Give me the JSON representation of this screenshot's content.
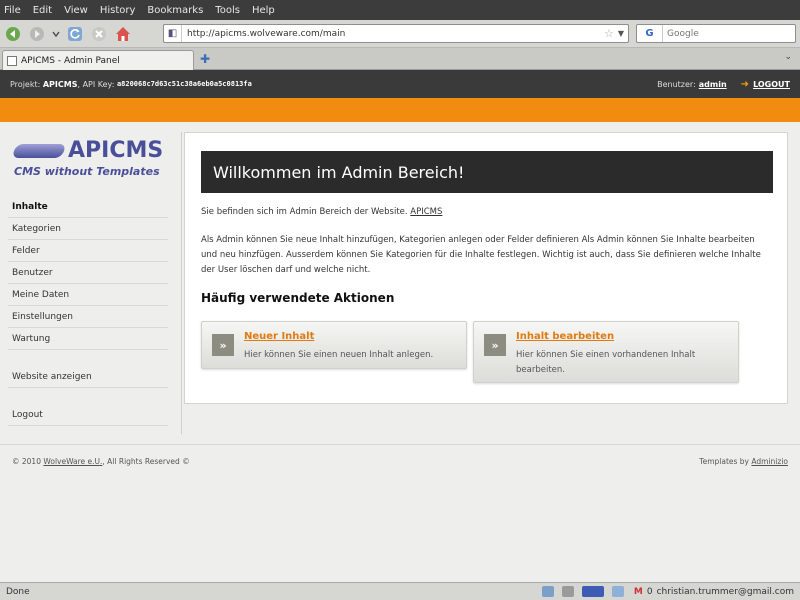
{
  "browser": {
    "menu": [
      "File",
      "Edit",
      "View",
      "History",
      "Bookmarks",
      "Tools",
      "Help"
    ],
    "url": "http://apicms.wolveware.com/main",
    "search_placeholder": "Google",
    "search_engine": "G",
    "tab_title": "APICMS - Admin Panel",
    "new_tab": "✚",
    "tab_list": "⌄",
    "status": "Done",
    "status_mail": "0",
    "status_email": "christian.trummer@gmail.com"
  },
  "adminbar": {
    "project_label": "Projekt:",
    "project_name": "APICMS",
    "api_label": "API Key:",
    "api_key": "a820068c7d63c51c38a6eb0a5c0813fa",
    "user_label": "Benutzer:",
    "user_name": "admin",
    "logout": "LOGOUT"
  },
  "logo": {
    "name": "APICMS",
    "tagline": "CMS without Templates"
  },
  "sidebar": {
    "items": [
      {
        "label": "Inhalte"
      },
      {
        "label": "Kategorien"
      },
      {
        "label": "Felder"
      },
      {
        "label": "Benutzer"
      },
      {
        "label": "Meine Daten"
      },
      {
        "label": "Einstellungen"
      },
      {
        "label": "Wartung"
      }
    ],
    "view_website": "Website anzeigen",
    "logout": "Logout"
  },
  "main": {
    "heading": "Willkommen im Admin Bereich!",
    "intro_prefix": "Sie befinden sich im Admin Bereich der Website.",
    "intro_link": "APICMS",
    "body": "Als Admin können Sie neue Inhalt hinzufügen, Kategorien anlegen oder Felder definieren Als Admin können Sie Inhalte bearbeiten und neu hinzfügen. Ausserdem können Sie Kategorien für die Inhalte festlegen. Wichtig ist auch, dass Sie definieren welche Inhalte der User löschen darf und welche nicht.",
    "actions_heading": "Häufig verwendete Aktionen",
    "actions": [
      {
        "icon": "»",
        "title": "Neuer Inhalt",
        "desc": "Hier können Sie einen neuen Inhalt anlegen."
      },
      {
        "icon": "»",
        "title": "Inhalt bearbeiten",
        "desc": "Hier können Sie einen vorhandenen Inhalt bearbeiten."
      }
    ]
  },
  "footer": {
    "copyright_prefix": "© 2010",
    "company": "WolveWare e.U.",
    "copyright_suffix": ", All Rights Reserved ©",
    "templates_prefix": "Templates by",
    "templates_author": "Adminizio"
  },
  "colors": {
    "accent_orange": "#f28c0f",
    "header_dark": "#3a3a3a",
    "logo_purple": "#4a4f9a"
  }
}
